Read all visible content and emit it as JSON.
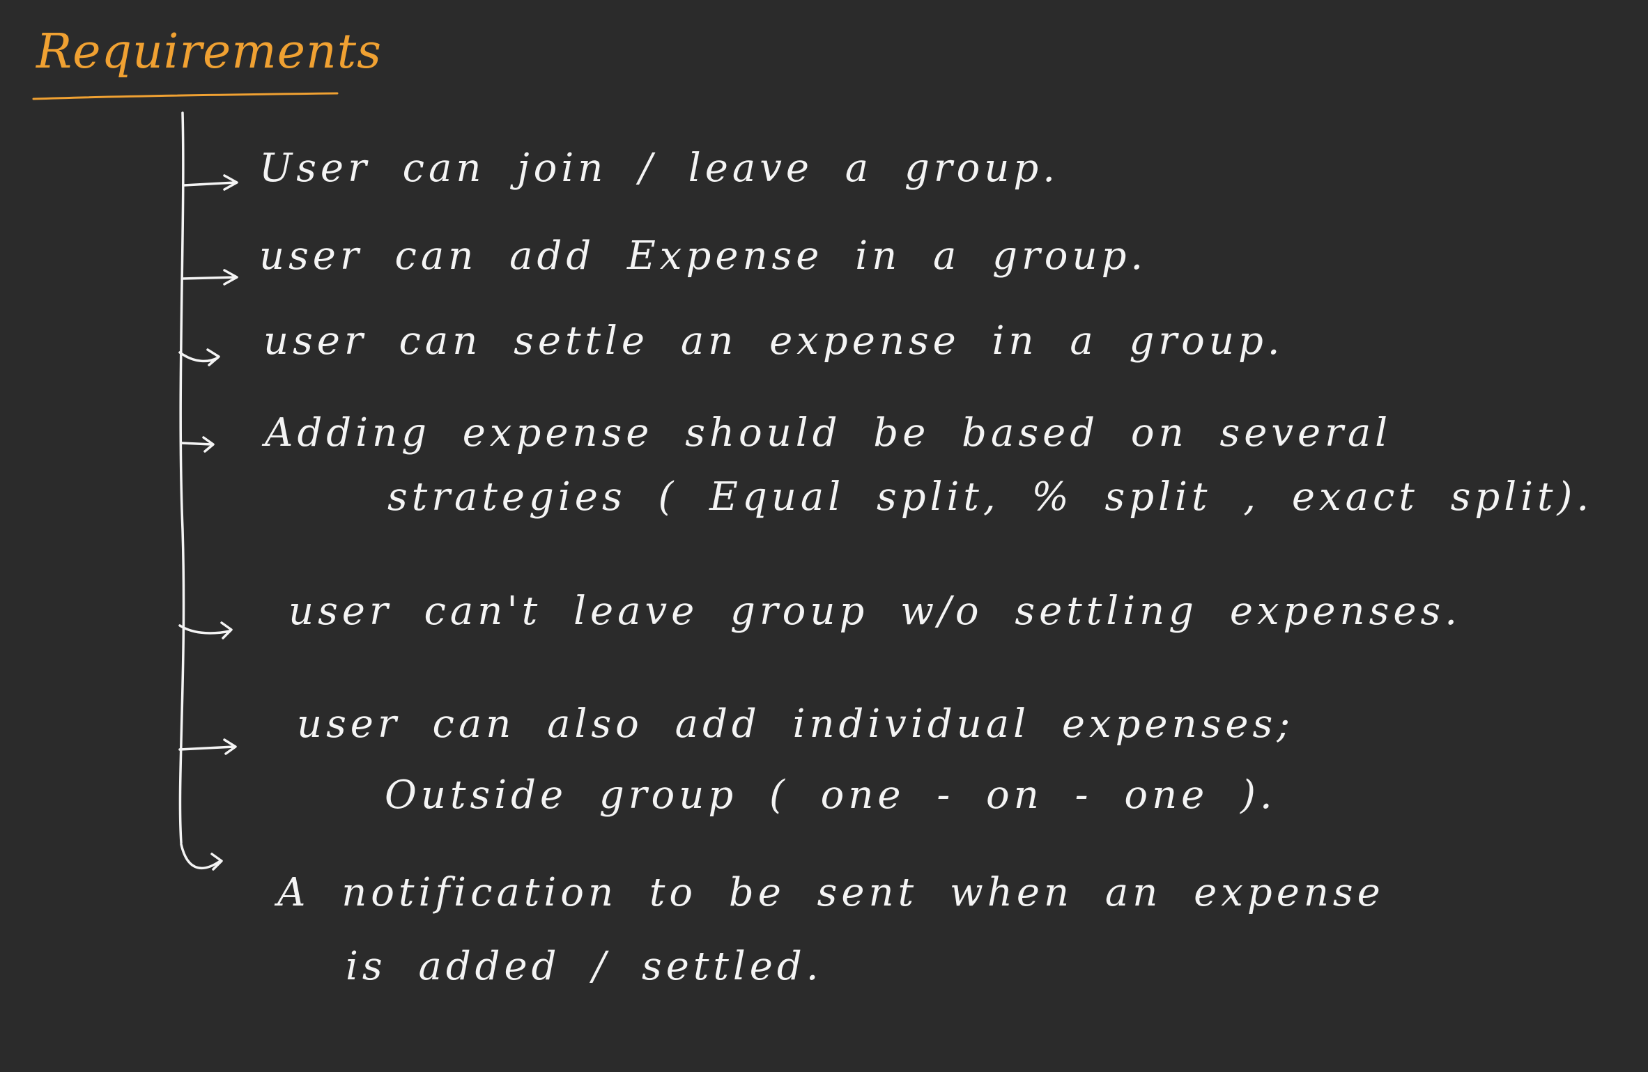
{
  "page": {
    "background": "#2b2b2b",
    "title": "Requirements",
    "title_color": "#f0a132",
    "ink_color": "#f4f4f4"
  },
  "requirements": [
    {
      "lines": [
        "User can join / leave a group."
      ]
    },
    {
      "lines": [
        "user can add Expense in a group."
      ]
    },
    {
      "lines": [
        "user can settle an expense in a group."
      ]
    },
    {
      "lines": [
        "Adding expense should be based on several",
        "strategies ( Equal split, % split , exact split)."
      ]
    },
    {
      "lines": [
        "user can't leave group w/o settling expenses."
      ]
    },
    {
      "lines": [
        "user can also add individual expenses;",
        "Outside group ( one - on - one )."
      ]
    },
    {
      "lines": [
        "A notification to be sent when an expense",
        "is added / settled."
      ]
    }
  ]
}
